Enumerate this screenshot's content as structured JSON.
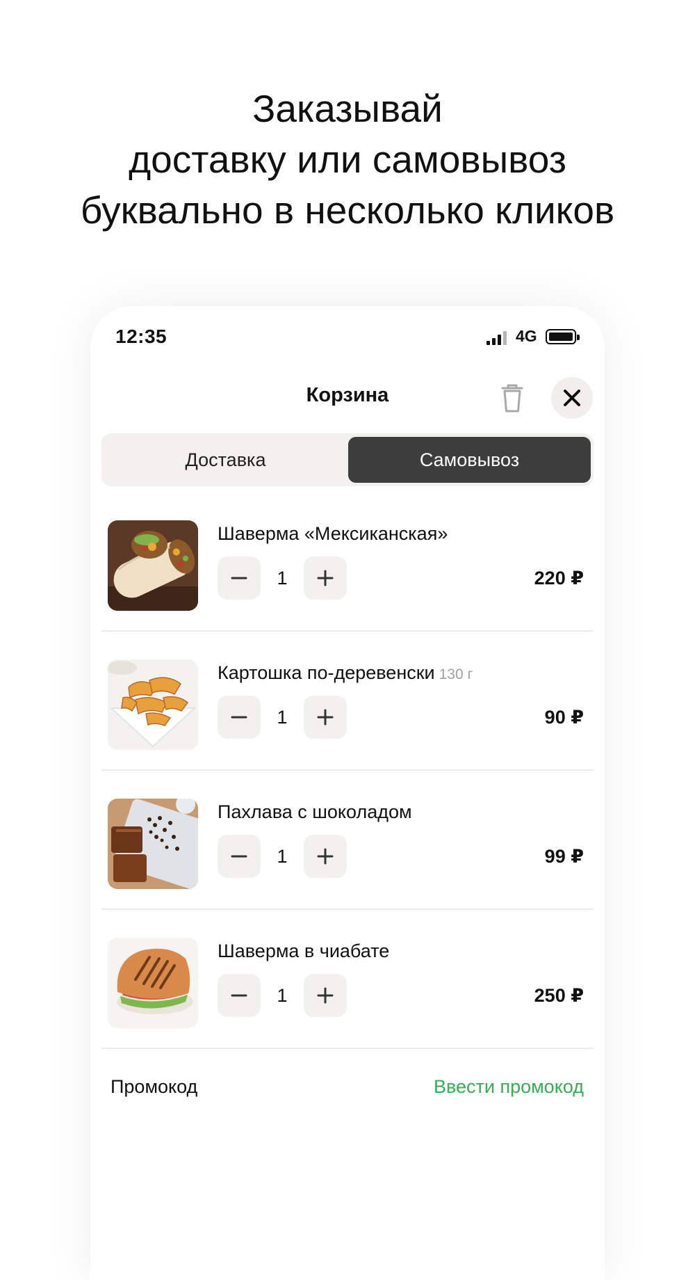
{
  "headline": {
    "line1": "Заказывай",
    "line2": "доставку или самовывоз",
    "line3": "буквально в несколько кликов"
  },
  "status_bar": {
    "time": "12:35",
    "network": "4G",
    "icons": [
      "signal-icon",
      "battery-icon"
    ]
  },
  "cart": {
    "title": "Корзина",
    "icons": {
      "clear": "trash-icon",
      "close": "close-icon"
    },
    "tabs": [
      {
        "label": "Доставка",
        "selected": false
      },
      {
        "label": "Самовывоз",
        "selected": true
      }
    ],
    "items": [
      {
        "name": "Шаверма «Мексиканская»",
        "weight": "",
        "qty": "1",
        "price": "220 ₽",
        "image": "wrap-photo"
      },
      {
        "name": "Картошка по-деревенски",
        "weight": "130 г",
        "qty": "1",
        "price": "90 ₽",
        "image": "potato-wedges-photo"
      },
      {
        "name": "Пахлава с шоколадом",
        "weight": "",
        "qty": "1",
        "price": "99 ₽",
        "image": "baklava-photo"
      },
      {
        "name": "Шаверма в чиабате",
        "weight": "",
        "qty": "1",
        "price": "250 ₽",
        "image": "ciabatta-sandwich-photo"
      }
    ],
    "promo": {
      "label": "Промокод",
      "action": "Ввести промокод"
    }
  },
  "colors": {
    "accent_green": "#2fb34f",
    "segment_active": "#3d3d3d",
    "segment_bg": "#f2f1ed"
  }
}
